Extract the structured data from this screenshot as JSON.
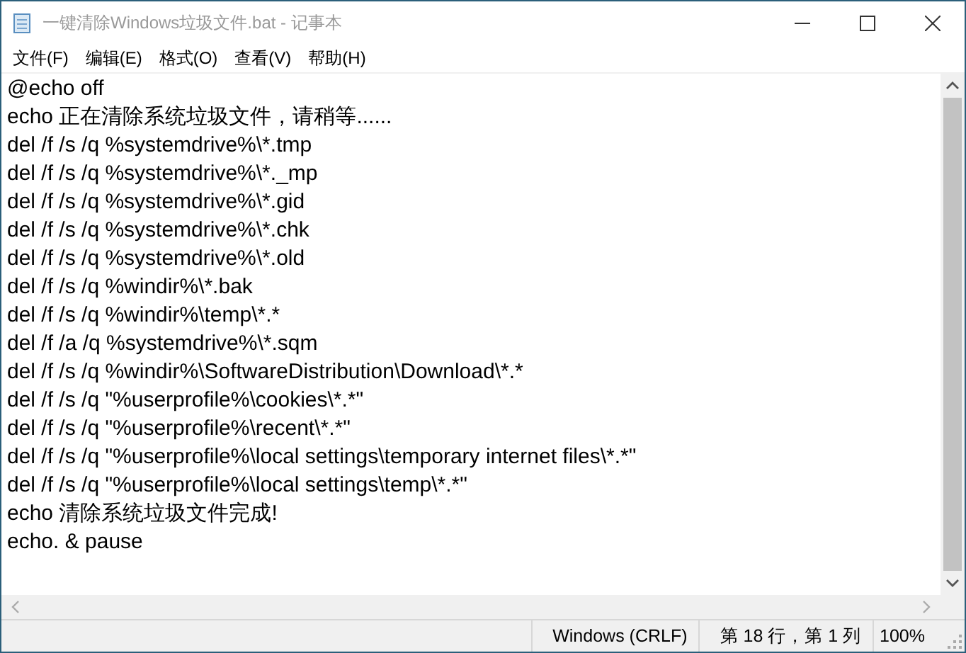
{
  "window": {
    "title": "一键清除Windows垃圾文件.bat - 记事本"
  },
  "menu": [
    "文件(F)",
    "编辑(E)",
    "格式(O)",
    "查看(V)",
    "帮助(H)"
  ],
  "editor": {
    "lines": [
      "@echo off",
      "echo 正在清除系统垃圾文件，请稍等......",
      "del /f /s /q %systemdrive%\\*.tmp",
      "del /f /s /q %systemdrive%\\*._mp",
      "del /f /s /q %systemdrive%\\*.gid",
      "del /f /s /q %systemdrive%\\*.chk",
      "del /f /s /q %systemdrive%\\*.old",
      "del /f /s /q %windir%\\*.bak",
      "del /f /s /q %windir%\\temp\\*.*",
      "del /f /a /q %systemdrive%\\*.sqm",
      "del /f /s /q %windir%\\SoftwareDistribution\\Download\\*.*",
      "del /f /s /q \"%userprofile%\\cookies\\*.*\"",
      "del /f /s /q \"%userprofile%\\recent\\*.*\"",
      "del /f /s /q \"%userprofile%\\local settings\\temporary internet files\\*.*\"",
      "del /f /s /q \"%userprofile%\\local settings\\temp\\*.*\"",
      "echo 清除系统垃圾文件完成!",
      "echo. & pause"
    ]
  },
  "status_bar": {
    "line_ending": "Windows (CRLF)",
    "position": "第 18 行，第 1 列",
    "zoom": "100%"
  }
}
